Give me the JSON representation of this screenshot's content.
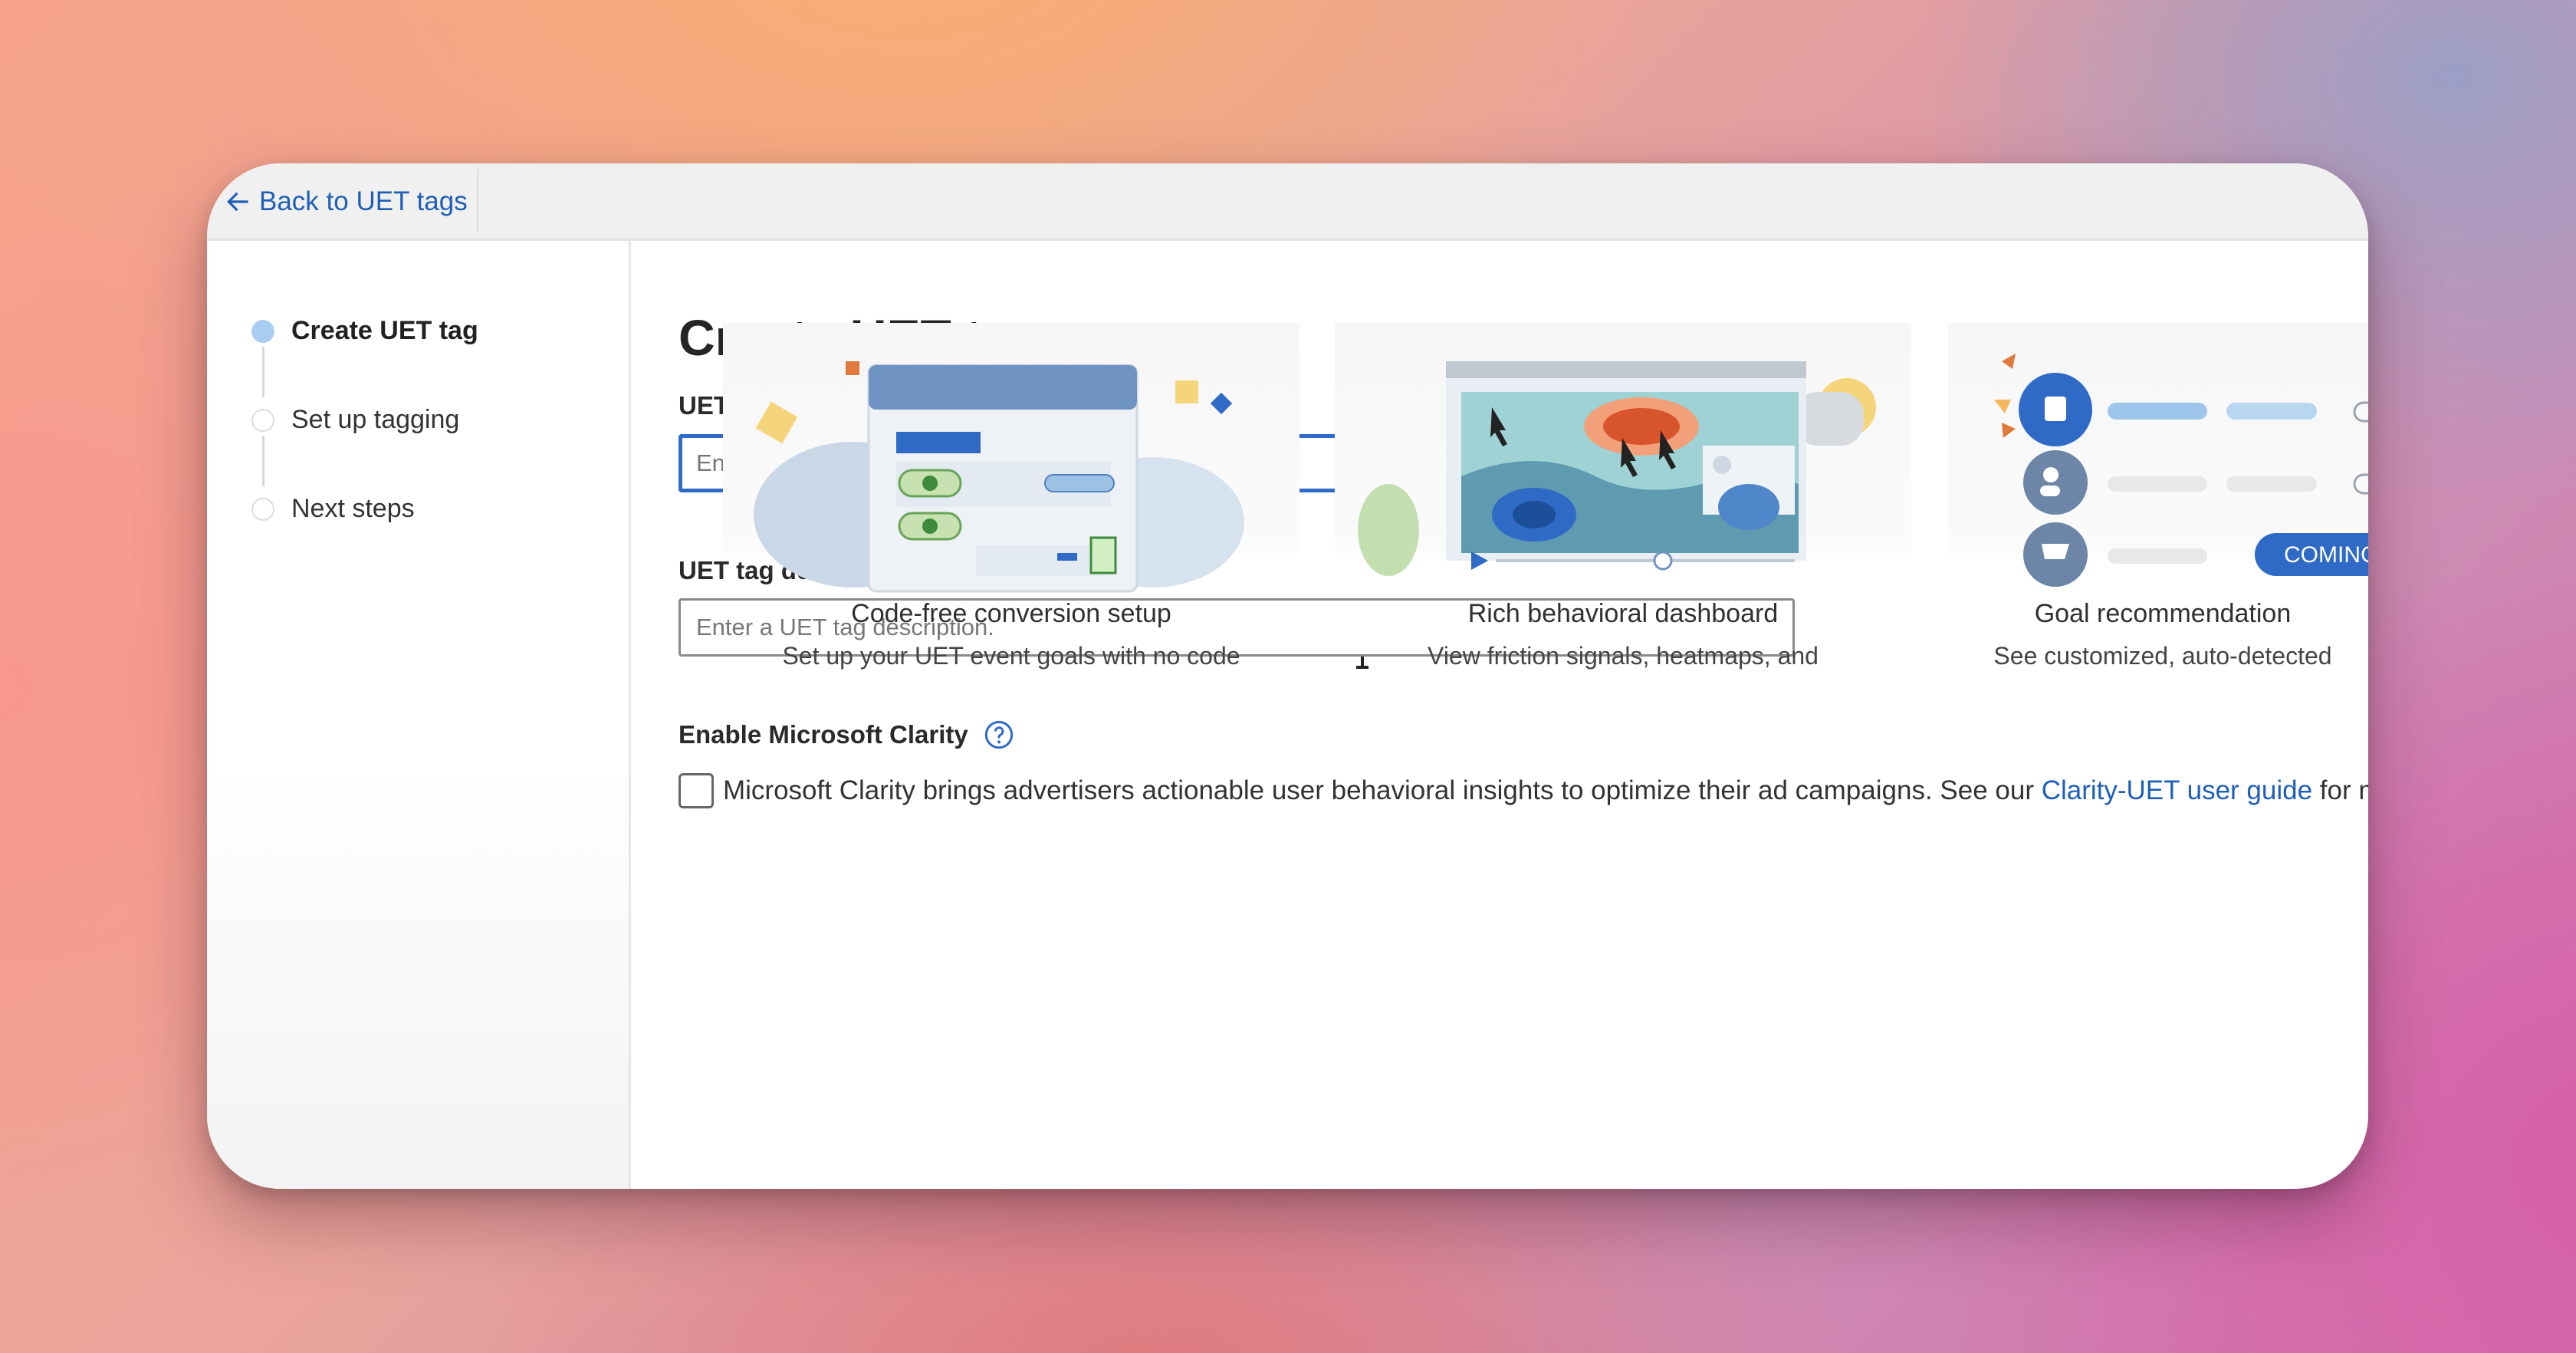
{
  "topbar": {
    "back_label": "Back to UET tags"
  },
  "sidebar": {
    "steps": [
      {
        "label": "Create UET tag",
        "active": true
      },
      {
        "label": "Set up tagging",
        "active": false
      },
      {
        "label": "Next steps",
        "active": false
      }
    ]
  },
  "main": {
    "title": "Create UET tag",
    "name_field": {
      "label": "UET tag name",
      "placeholder": "Enter a UET tag name.",
      "value": ""
    },
    "description_field": {
      "label": "UET tag description",
      "placeholder": "Enter a UET tag description.",
      "value": ""
    },
    "clarity": {
      "label": "Enable Microsoft Clarity",
      "checked": false,
      "text_before": "Microsoft Clarity brings advertisers actionable user behavioral insights to optimize their ad campaigns. See our ",
      "link_text": "Clarity-UET user guide",
      "text_after": " for more i"
    },
    "cards": [
      {
        "title": "Code-free conversion setup",
        "subtitle": "Set up your UET event goals with no code"
      },
      {
        "title": "Rich behavioral dashboard",
        "subtitle": "View friction signals, heatmaps, and"
      },
      {
        "title": "Goal recommendation",
        "subtitle": "See customized, auto-detected",
        "badge": "COMING"
      }
    ]
  },
  "colors": {
    "accent": "#2f6bc6",
    "link": "#1f5fb5",
    "step_active": "#a9cdf1"
  }
}
